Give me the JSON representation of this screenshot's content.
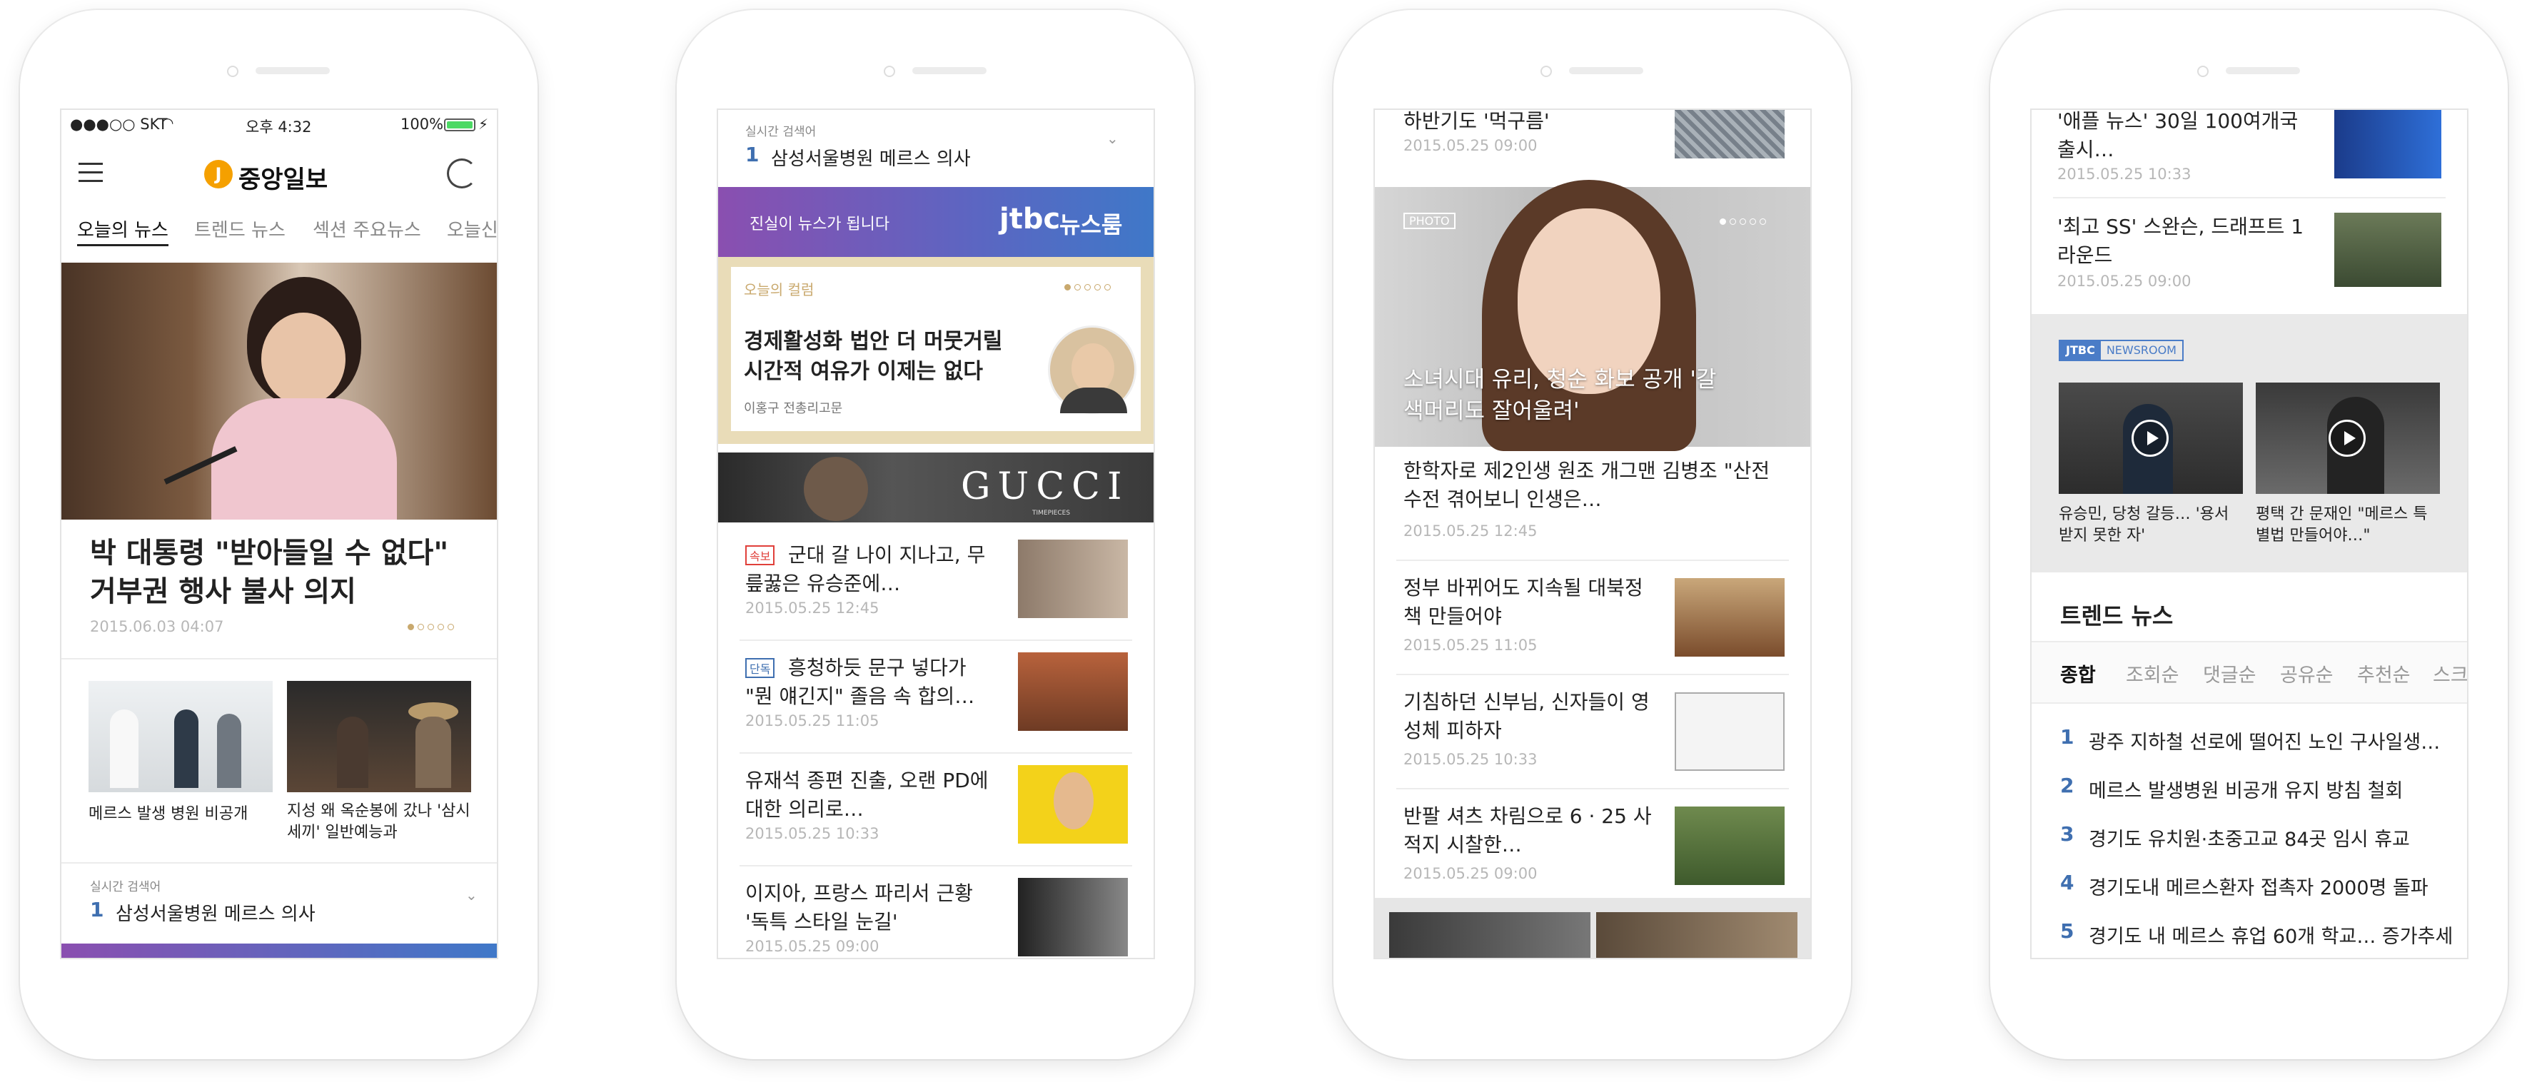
{
  "phone1": {
    "status": {
      "carrier": "●●●○○ SKT",
      "time": "오후 4:32",
      "battery": "100%"
    },
    "app": {
      "logo_mark": "J",
      "logo_text": "중앙일보"
    },
    "tabs": [
      "오늘의 뉴스",
      "트렌드 뉴스",
      "섹션 주요뉴스",
      "오늘신"
    ],
    "hero": {
      "title": "박 대통령 \"받아들일 수 없다\" 거부권 행사 불사 의지",
      "date": "2015.06.03 04:07"
    },
    "cards": [
      {
        "caption": "메르스 발생 병원 비공개"
      },
      {
        "caption": "지성 왜 옥순봉에 갔나 '삼시세끼' 일반예능과"
      }
    ],
    "realtime": {
      "label": "실시간 검색어",
      "rank": "1",
      "keyword": "삼성서울병원 메르스 의사"
    }
  },
  "phone2": {
    "realtime": {
      "label": "실시간 검색어",
      "rank": "1",
      "keyword": "삼성서울병원 메르스 의사"
    },
    "jtbc": {
      "slogan": "진실이 뉴스가 됩니다",
      "logo": "jtbc",
      "newsroom": "뉴스룸"
    },
    "column": {
      "label": "오늘의 컬럼",
      "title": "경제활성화 법안 더 머뭇거릴 시간적 여유가 이제는 없다",
      "author": "이홍구 전총리고문"
    },
    "ad": {
      "brand": "GUCCI",
      "sub": "TIMEPIECES"
    },
    "news": [
      {
        "badge": "속보",
        "title": "군대 갈 나이 지나고, 무릎꿇은 유승준에…",
        "date": "2015.05.25 12:45"
      },
      {
        "badge": "단독",
        "title": "흥청하듯 문구 넣다가 \"뭔 얘긴지\" 졸음 속 합의…",
        "date": "2015.05.25 11:05"
      },
      {
        "badge": "",
        "title": "유재석 종편 진출, 오랜 PD에 대한 의리로…",
        "date": "2015.05.25 10:33"
      },
      {
        "badge": "",
        "title": "이지아, 프랑스 파리서 근황 '독특 스타일 눈길'",
        "date": "2015.05.25 09:00"
      }
    ]
  },
  "phone3": {
    "top_item": {
      "title": "하반기도 '먹구름'",
      "date": "2015.05.25 09:00"
    },
    "photo": {
      "badge": "PHOTO",
      "caption": "소녀시대 유리, 청순 화보 공개 '갈색머리도 잘어울려'"
    },
    "news": [
      {
        "title": "한학자로 제2인생 원조 개그맨 김병조 \"산전수전 겪어보니 인생은…",
        "date": "2015.05.25 12:45"
      },
      {
        "title": "정부 바뀌어도 지속될 대북정책 만들어야",
        "date": "2015.05.25 11:05"
      },
      {
        "title": "기침하던 신부님, 신자들이 영성체 피하자",
        "date": "2015.05.25 10:33"
      },
      {
        "title": "반팔 셔츠 차림으로 6 · 25 사적지 시찰한…",
        "date": "2015.05.25 09:00"
      }
    ]
  },
  "phone4": {
    "top": [
      {
        "title": "'애플 뉴스' 30일 100여개국 출시…",
        "date": "2015.05.25 10:33"
      },
      {
        "title": "'최고 SS' 스완슨, 드래프트 1라운드",
        "date": "2015.05.25 09:00"
      }
    ],
    "jtbc": {
      "brand": "JTBC",
      "label": "NEWSROOM"
    },
    "videos": [
      {
        "caption": "유승민, 당청 갈등… '용서받지 못한 자'"
      },
      {
        "caption": "평택 간 문재인 \"메르스 특별법 만들어야…\""
      }
    ],
    "trend": {
      "heading": "트렌드 뉴스",
      "tabs": [
        "종합",
        "조회순",
        "댓글순",
        "공유순",
        "추천순",
        "스크"
      ],
      "items": [
        {
          "rank": "1",
          "title": "광주 지하철 선로에 떨어진 노인 구사일생…"
        },
        {
          "rank": "2",
          "title": "메르스 발생병원 비공개 유지 방침 철회"
        },
        {
          "rank": "3",
          "title": "경기도 유치원·초중고교 84곳 임시 휴교"
        },
        {
          "rank": "4",
          "title": "경기도내 메르스환자 접촉자 2000명 돌파"
        },
        {
          "rank": "5",
          "title": "경기도 내 메르스 휴업 60개 학교… 증가추세"
        }
      ]
    },
    "colors": {
      "accent": "#3f6fb0",
      "jtbc_gradient_start": "#8a4fb0",
      "jtbc_gradient_end": "#3f78c8",
      "logo_orange": "#f5a000"
    }
  }
}
